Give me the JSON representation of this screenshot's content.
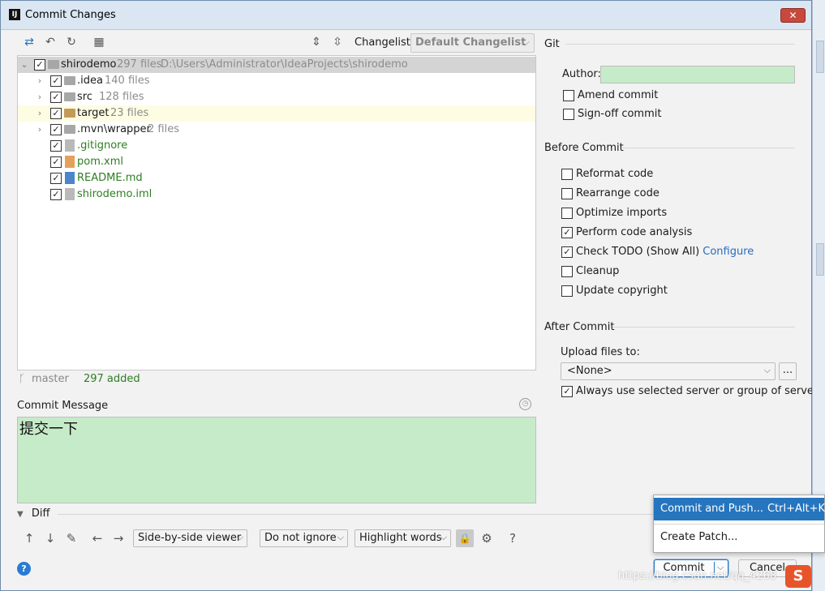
{
  "window": {
    "title": "Commit Changes",
    "logo_text": "IJ",
    "close_glyph": "✕"
  },
  "toolbar": {
    "changelist_label": "Changelist:",
    "changelist_value": "Default Changelist",
    "icons": [
      "diff-arrows-icon",
      "undo-icon",
      "refresh-icon",
      "group-by-icon",
      "expand-all-icon",
      "collapse-all-icon"
    ]
  },
  "tree": {
    "root": {
      "name": "shirodemo",
      "count": "297 files",
      "path": "D:\\Users\\Administrator\\IdeaProjects\\shirodemo"
    },
    "folders": [
      {
        "name": ".idea",
        "count": "140 files"
      },
      {
        "name": "src",
        "count": "128 files"
      },
      {
        "name": "target",
        "count": "23 files"
      },
      {
        "name": ".mvn\\wrapper",
        "count": "2 files"
      }
    ],
    "files": [
      {
        "name": ".gitignore"
      },
      {
        "name": "pom.xml"
      },
      {
        "name": "README.md"
      },
      {
        "name": "shirodemo.iml"
      }
    ]
  },
  "status": {
    "branch": "master",
    "added": "297 added"
  },
  "commit_message": {
    "label": "Commit Message",
    "text": "提交一下"
  },
  "diff": {
    "header": "Diff",
    "viewer": "Side-by-side viewer",
    "ignore": "Do not ignore",
    "highlight": "Highlight words",
    "help": "?"
  },
  "git": {
    "title": "Git",
    "author_label": "Author:",
    "author_value": "",
    "amend": {
      "label": "Amend commit",
      "checked": false
    },
    "signoff": {
      "label": "Sign-off commit",
      "checked": false
    }
  },
  "before_commit": {
    "title": "Before Commit",
    "reformat": {
      "label": "Reformat code",
      "checked": false
    },
    "rearrange": {
      "label": "Rearrange code",
      "checked": false
    },
    "optimize": {
      "label": "Optimize imports",
      "checked": false
    },
    "analysis": {
      "label": "Perform code analysis",
      "checked": true
    },
    "todo": {
      "label": "Check TODO (Show All)",
      "link": "Configure",
      "checked": true
    },
    "cleanup": {
      "label": "Cleanup",
      "checked": false
    },
    "copyright": {
      "label": "Update copyright",
      "checked": false
    }
  },
  "after_commit": {
    "title": "After Commit",
    "upload_label": "Upload files to:",
    "upload_value": "<None>",
    "browse": "...",
    "always_use": {
      "label": "Always use selected server or group of servers",
      "checked": true
    }
  },
  "popup": {
    "commit_push": "Commit and Push...",
    "commit_push_shortcut": "Ctrl+Alt+K",
    "create_patch": "Create Patch..."
  },
  "buttons": {
    "commit": "Commit",
    "cancel": "Cancel"
  },
  "watermark": {
    "text": "https://blog.csdn.net/qq_4268",
    "logo": "S"
  },
  "colors": {
    "accent": "#2675bf",
    "message_bg": "#c6ebc8",
    "added_green": "#2e7d22"
  }
}
